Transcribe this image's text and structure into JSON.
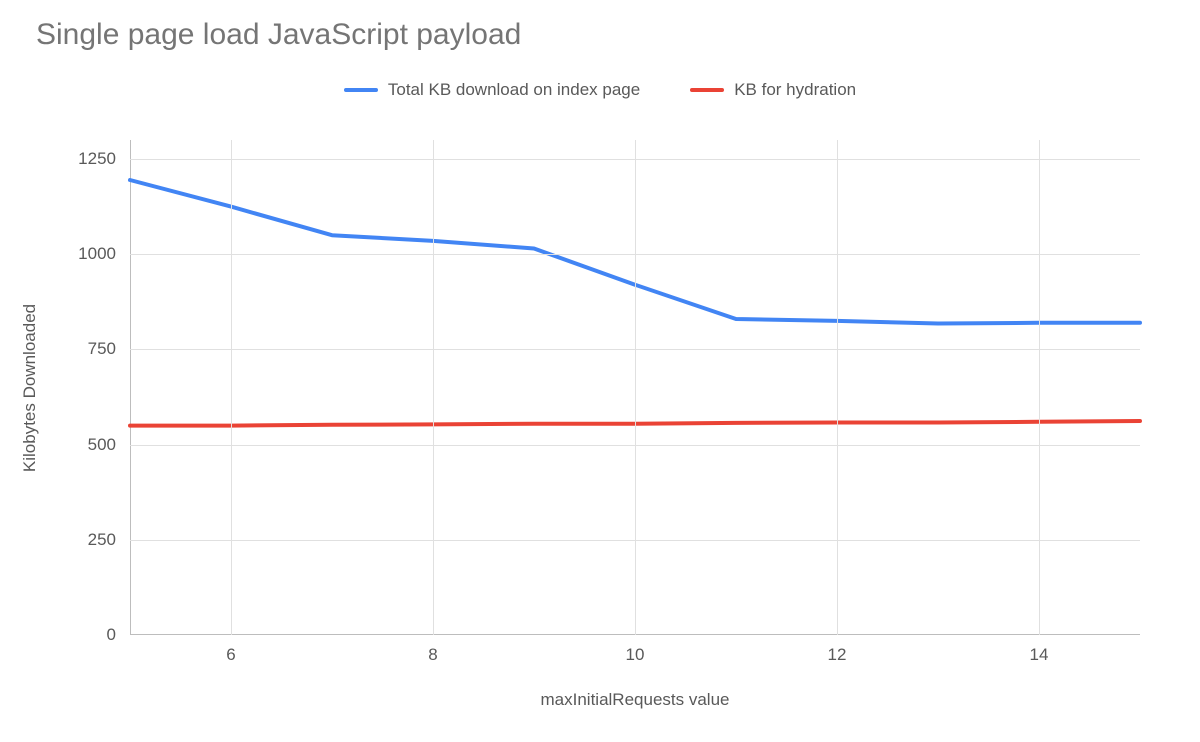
{
  "chart_data": {
    "type": "line",
    "title": "Single page load JavaScript payload",
    "xlabel": "maxInitialRequests value",
    "ylabel": "Kilobytes Downloaded",
    "x": [
      5,
      6,
      7,
      8,
      9,
      10,
      11,
      12,
      13,
      14,
      15
    ],
    "x_ticks": [
      6,
      8,
      10,
      12,
      14
    ],
    "y_ticks": [
      0,
      250,
      500,
      750,
      1000,
      1250
    ],
    "xlim": [
      5,
      15
    ],
    "ylim": [
      0,
      1300
    ],
    "legend_position": "top-center",
    "grid": true,
    "series": [
      {
        "name": "Total KB download on index page",
        "color": "#4285F4",
        "values": [
          1195,
          1125,
          1050,
          1035,
          1015,
          920,
          830,
          825,
          818,
          820,
          820
        ]
      },
      {
        "name": "KB for hydration",
        "color": "#EA4335",
        "values": [
          550,
          550,
          552,
          553,
          555,
          555,
          557,
          558,
          558,
          560,
          562
        ]
      }
    ]
  }
}
